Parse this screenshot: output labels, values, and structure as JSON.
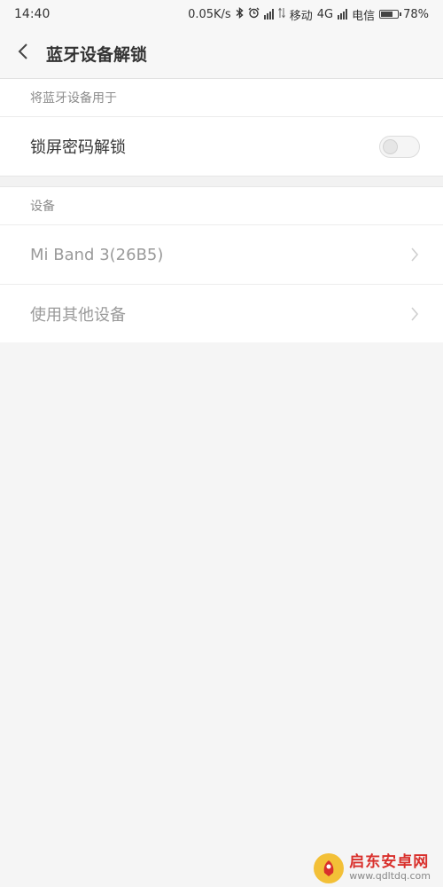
{
  "status_bar": {
    "time": "14:40",
    "speed": "0.05K/s",
    "carrier1": "移动",
    "network": "4G",
    "carrier2": "电信",
    "battery": "78%",
    "battery_level": 0.78
  },
  "header": {
    "title": "蓝牙设备解锁"
  },
  "section_use": {
    "header": "将蓝牙设备用于",
    "items": [
      {
        "label": "锁屏密码解锁",
        "toggle_on": false
      }
    ]
  },
  "section_devices": {
    "header": "设备",
    "items": [
      {
        "label": "Mi Band 3(26B5)"
      },
      {
        "label": "使用其他设备"
      }
    ]
  },
  "watermark": {
    "name": "启东安卓网",
    "url": "www.qdltdq.com"
  },
  "colors": {
    "background": "#f5f5f5",
    "text_primary": "#333333",
    "text_muted": "#9a9a9a",
    "watermark_red": "#d9302c",
    "watermark_logo": "#f3c037"
  }
}
